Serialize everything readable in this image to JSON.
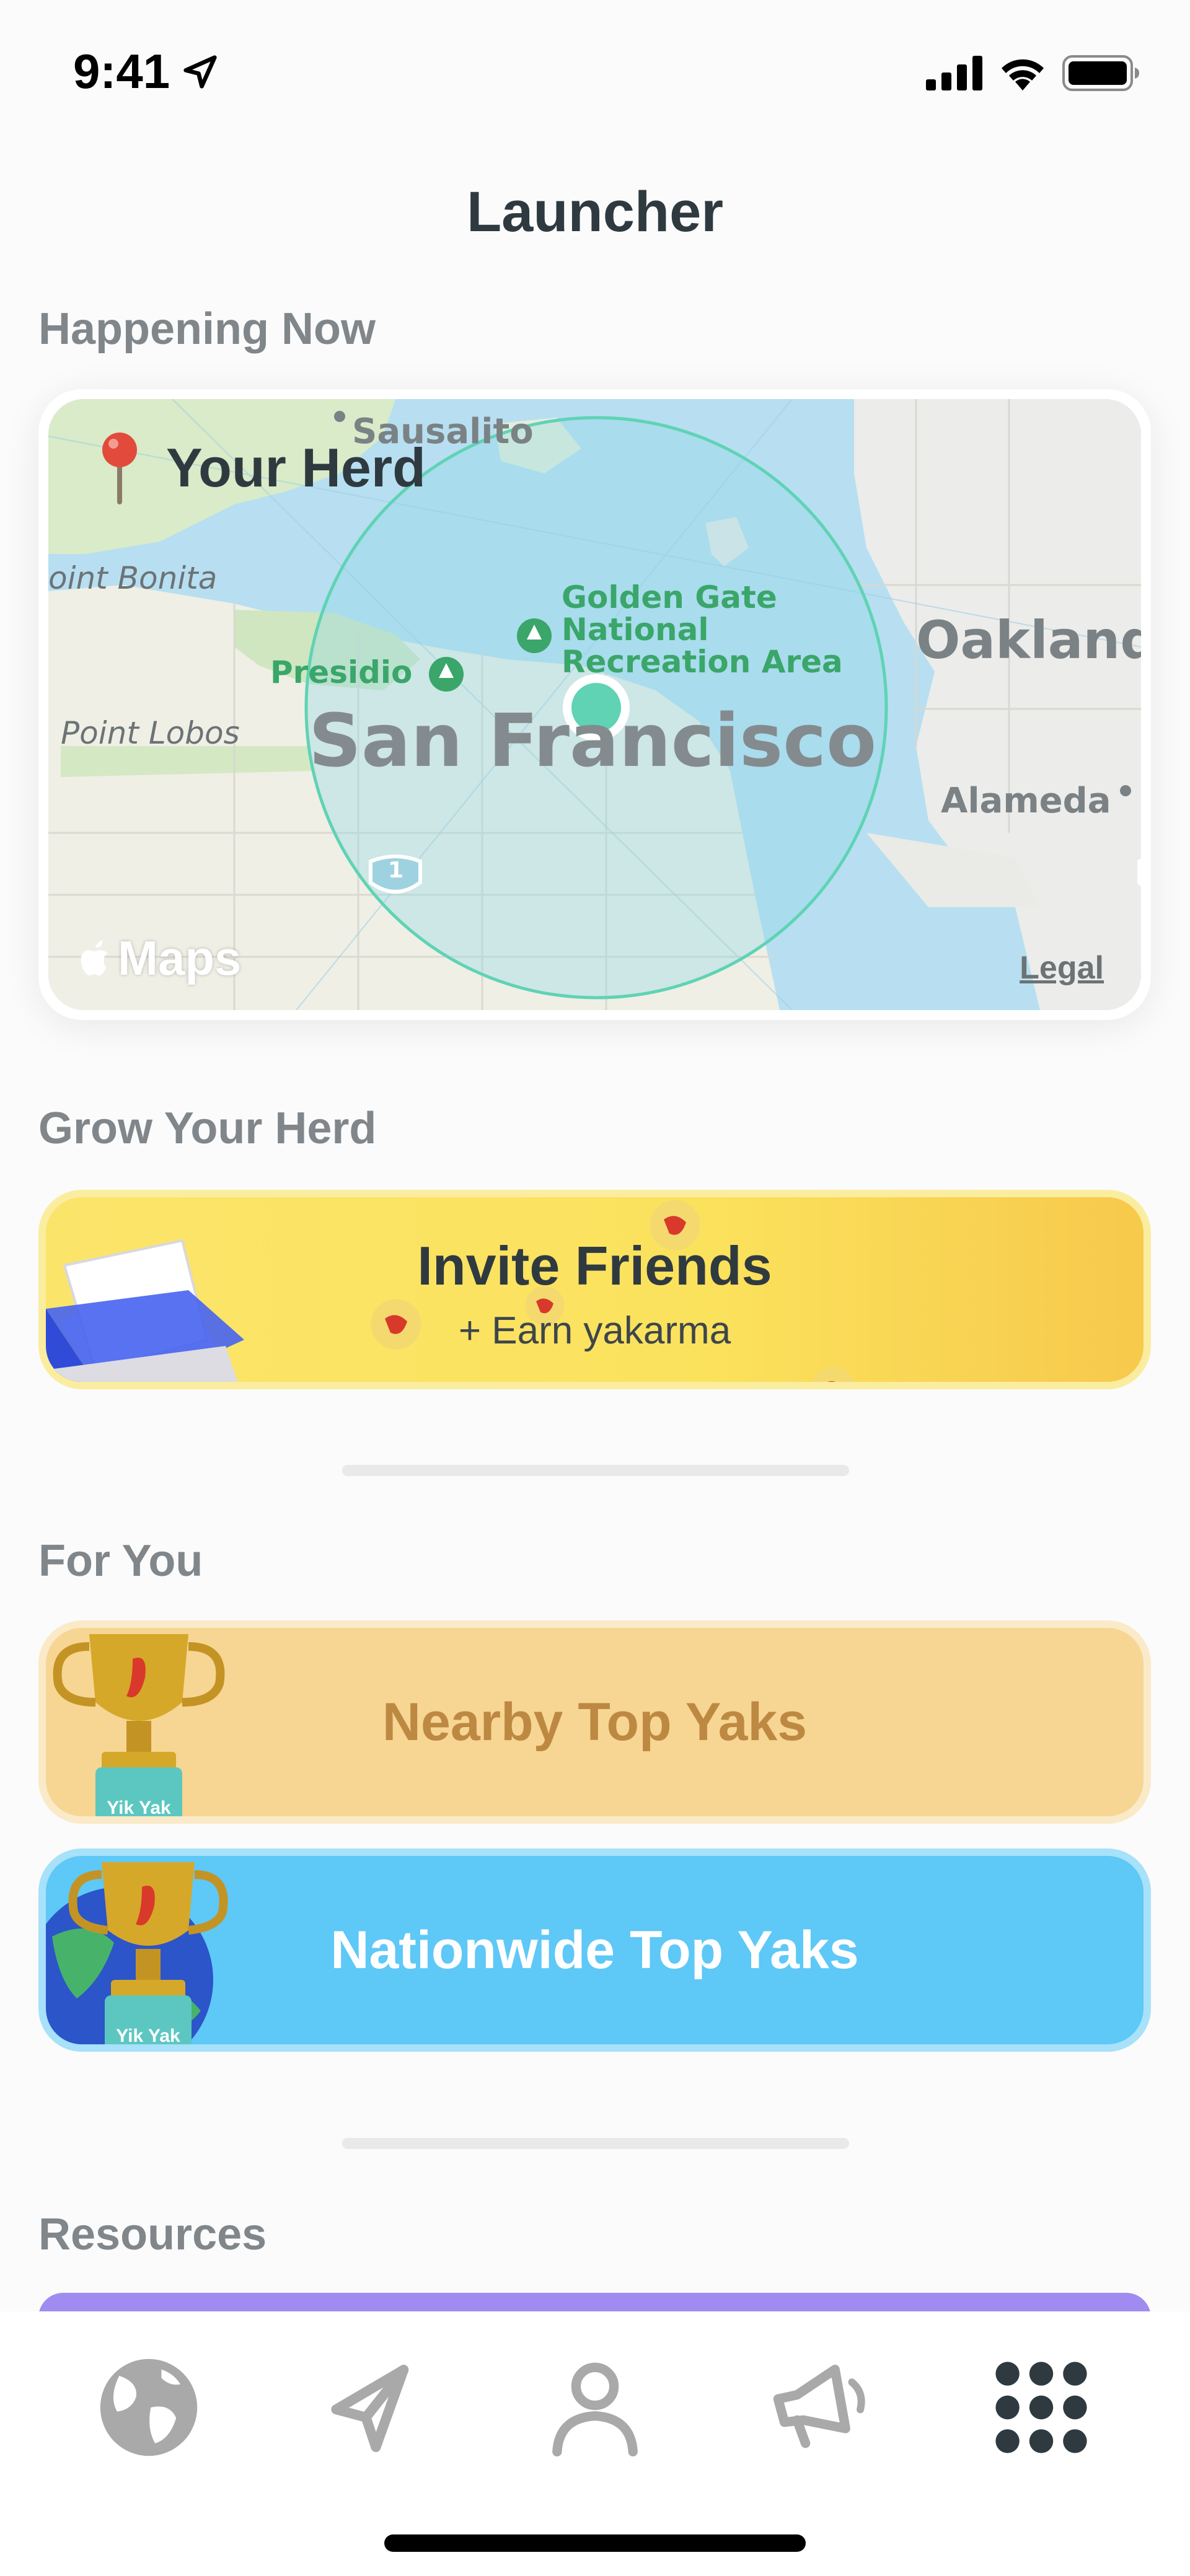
{
  "status_bar": {
    "time": "9:41"
  },
  "header": {
    "title": "Launcher"
  },
  "happening_now": {
    "heading": "Happening Now",
    "map": {
      "title": "Your Herd",
      "labels": {
        "sausalito": "Sausalito",
        "point_bonita": "oint Bonita",
        "golden_gate_1": "Golden Gate",
        "golden_gate_2": "National",
        "golden_gate_3": "Recreation Area",
        "oakland": "Oakland",
        "presidio": "Presidio",
        "point_lobos": "Point Lobos",
        "san_francisco": "San Francisco",
        "alameda": "Alameda",
        "route": "1"
      },
      "attribution": "Maps",
      "legal": "Legal"
    }
  },
  "grow": {
    "heading": "Grow Your Herd",
    "invite_title": "Invite Friends",
    "invite_subtitle": "+ Earn yakarma"
  },
  "for_you": {
    "heading": "For You",
    "nearby_label": "Nearby Top Yaks",
    "nationwide_label": "Nationwide Top Yaks",
    "trophy_text": "Yik Yak"
  },
  "resources": {
    "heading": "Resources"
  },
  "tab_bar": {
    "items": [
      "globe-icon",
      "send-icon",
      "profile-icon",
      "megaphone-icon",
      "grid-icon"
    ],
    "active": "grid-icon"
  },
  "colors": {
    "invite_yellow": "#fbe25d",
    "nearby_orange": "#f7d593",
    "nationwide_blue": "#5ec8f7",
    "map_water": "#b8dff0",
    "herd_circle": "#5fd3b4"
  }
}
